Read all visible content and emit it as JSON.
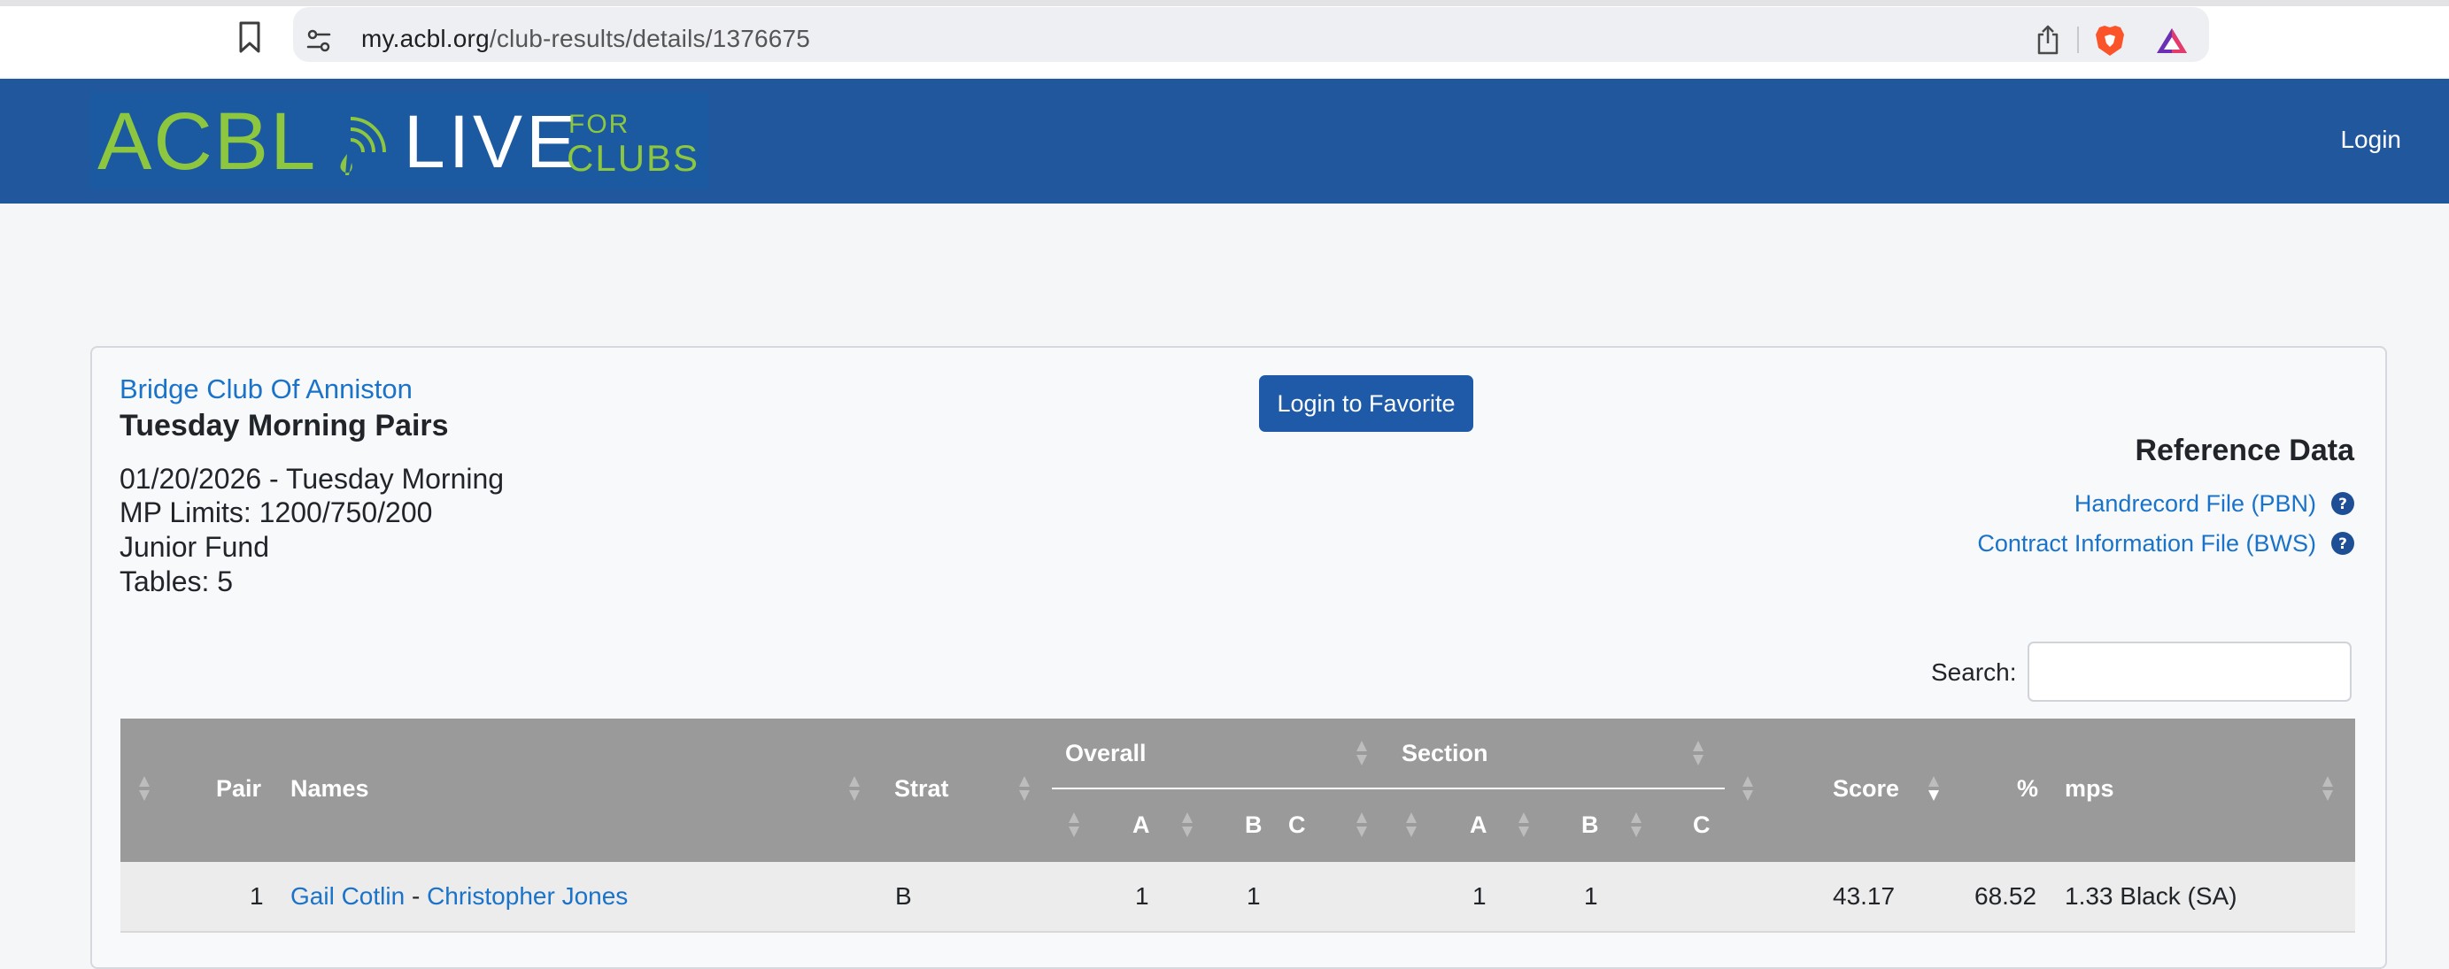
{
  "browser": {
    "url_host": "my.acbl.org",
    "url_path": "/club-results/details/1376675"
  },
  "header": {
    "logo": {
      "acbl": "ACBL",
      "live": "LIVE",
      "for": "FOR",
      "clubs": "CLUBS"
    },
    "login_label": "Login"
  },
  "event": {
    "club_name": "Bridge Club Of Anniston",
    "title": "Tuesday Morning Pairs",
    "date_line": "01/20/2026 - Tuesday Morning",
    "mp_limits": "MP Limits: 1200/750/200",
    "fund": "Junior Fund",
    "tables": "Tables: 5",
    "favorite_button": "Login to Favorite"
  },
  "reference": {
    "title": "Reference Data",
    "links": [
      {
        "label": "Handrecord File (PBN)"
      },
      {
        "label": "Contract Information File (BWS)"
      }
    ]
  },
  "search": {
    "label": "Search:",
    "placeholder": ""
  },
  "table": {
    "headers": {
      "pair": "Pair",
      "names": "Names",
      "strat": "Strat",
      "overall": "Overall",
      "section": "Section",
      "a": "A",
      "b": "B",
      "c": "C",
      "score": "Score",
      "pct": "%",
      "mps": "mps"
    },
    "rows": [
      {
        "pair": "1",
        "player1": "Gail Cotlin",
        "separator": " - ",
        "player2": "Christopher Jones",
        "strat": "B",
        "overall_a": "1",
        "overall_b": "1",
        "overall_c": "",
        "section_a": "1",
        "section_b": "1",
        "section_c": "",
        "score": "43.17",
        "pct": "68.52",
        "mps": "1.33 Black (SA)"
      }
    ]
  },
  "colors": {
    "header_bg": "#21579c",
    "logo_green": "#8dc63f",
    "link": "#1a73c9",
    "button": "#1e5aa8",
    "table_header": "#9a9a9a"
  }
}
